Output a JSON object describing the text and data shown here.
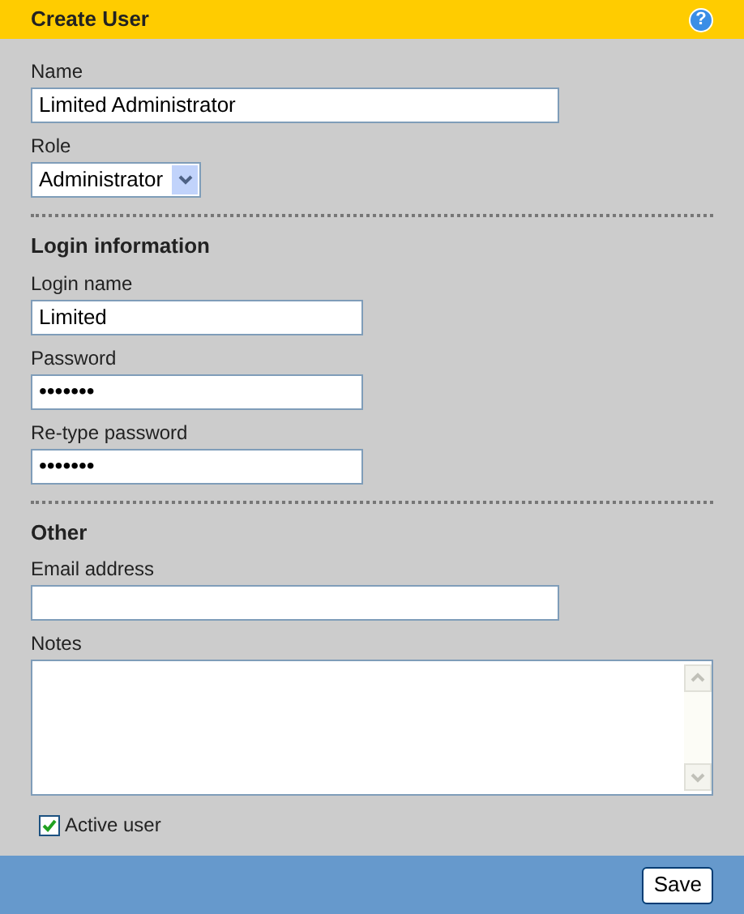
{
  "header": {
    "title": "Create User",
    "help_icon": "?"
  },
  "sections": [
    {
      "fields": [
        {
          "kind": "text",
          "label": "Name",
          "value": "Limited Administrator"
        },
        {
          "kind": "select",
          "label": "Role",
          "value": "Administrator"
        }
      ]
    },
    {
      "heading": "Login information",
      "fields": [
        {
          "kind": "text",
          "label": "Login name",
          "value": "Limited"
        },
        {
          "kind": "password",
          "label": "Password",
          "value": "•••••••"
        },
        {
          "kind": "password",
          "label": "Re-type password",
          "value": "•••••••"
        }
      ]
    },
    {
      "heading": "Other",
      "fields": [
        {
          "kind": "text",
          "label": "Email address"
        },
        {
          "kind": "textarea",
          "label": "Notes"
        }
      ]
    }
  ],
  "active_user": {
    "label": "Active user",
    "checked": true
  },
  "footer": {
    "save_button": "Save"
  }
}
